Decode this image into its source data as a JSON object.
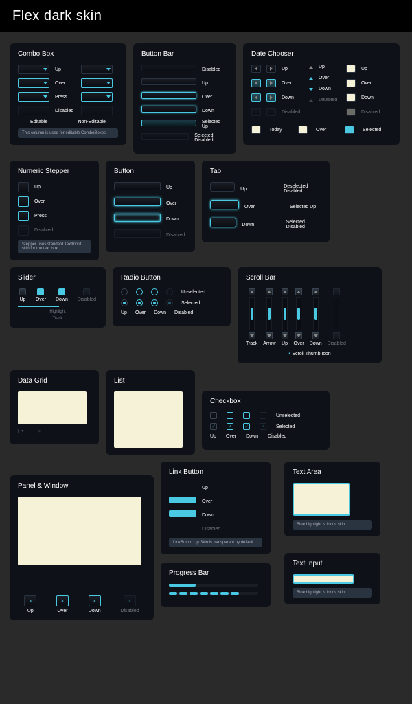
{
  "title": "Flex dark skin",
  "states": {
    "up": "Up",
    "over": "Over",
    "press": "Press",
    "down": "Down",
    "disabled": "Disabled"
  },
  "combo": {
    "title": "Combo Box",
    "editable": "Editable",
    "noneditable": "Non-Editable",
    "tip": "This column is used for editable ComboBoxes"
  },
  "buttonbar": {
    "title": "Button Bar",
    "selUp": "Selected Up",
    "selDis": "Selected Disabled"
  },
  "datechooser": {
    "title": "Date Chooser",
    "today": "Today",
    "over": "Over",
    "selected": "Selected"
  },
  "stepper": {
    "title": "Numeric Stepper",
    "tip": "Stepper uses standard TextInput skin for the text box"
  },
  "button": {
    "title": "Button"
  },
  "tab": {
    "title": "Tab",
    "deselDis": "Deselected Disabled",
    "selUp": "Selected Up",
    "selDis": "Selected Disabled"
  },
  "slider": {
    "title": "Slider",
    "highlight": "Highlight",
    "track": "Track"
  },
  "radio": {
    "title": "Radio Button",
    "unsel": "Unselected",
    "sel": "Selected"
  },
  "scroll": {
    "title": "Scroll Bar",
    "track": "Track",
    "arrow": "Arrow",
    "legend": "Scroll Thumb Icon"
  },
  "datagrid": {
    "title": "Data Grid"
  },
  "list": {
    "title": "List"
  },
  "checkbox": {
    "title": "Checkbox",
    "unsel": "Unselected",
    "sel": "Selected"
  },
  "panelwin": {
    "title": "Panel & Window"
  },
  "linkbtn": {
    "title": "Link Button",
    "tip": "LinkButton Up Skin is transparent by default"
  },
  "textarea": {
    "title": "Text Area",
    "tip": "Blue highlight is focus skin"
  },
  "progress": {
    "title": "Progress Bar"
  },
  "textinput": {
    "title": "Text Input",
    "tip": "Blue highlight is focus skin"
  }
}
